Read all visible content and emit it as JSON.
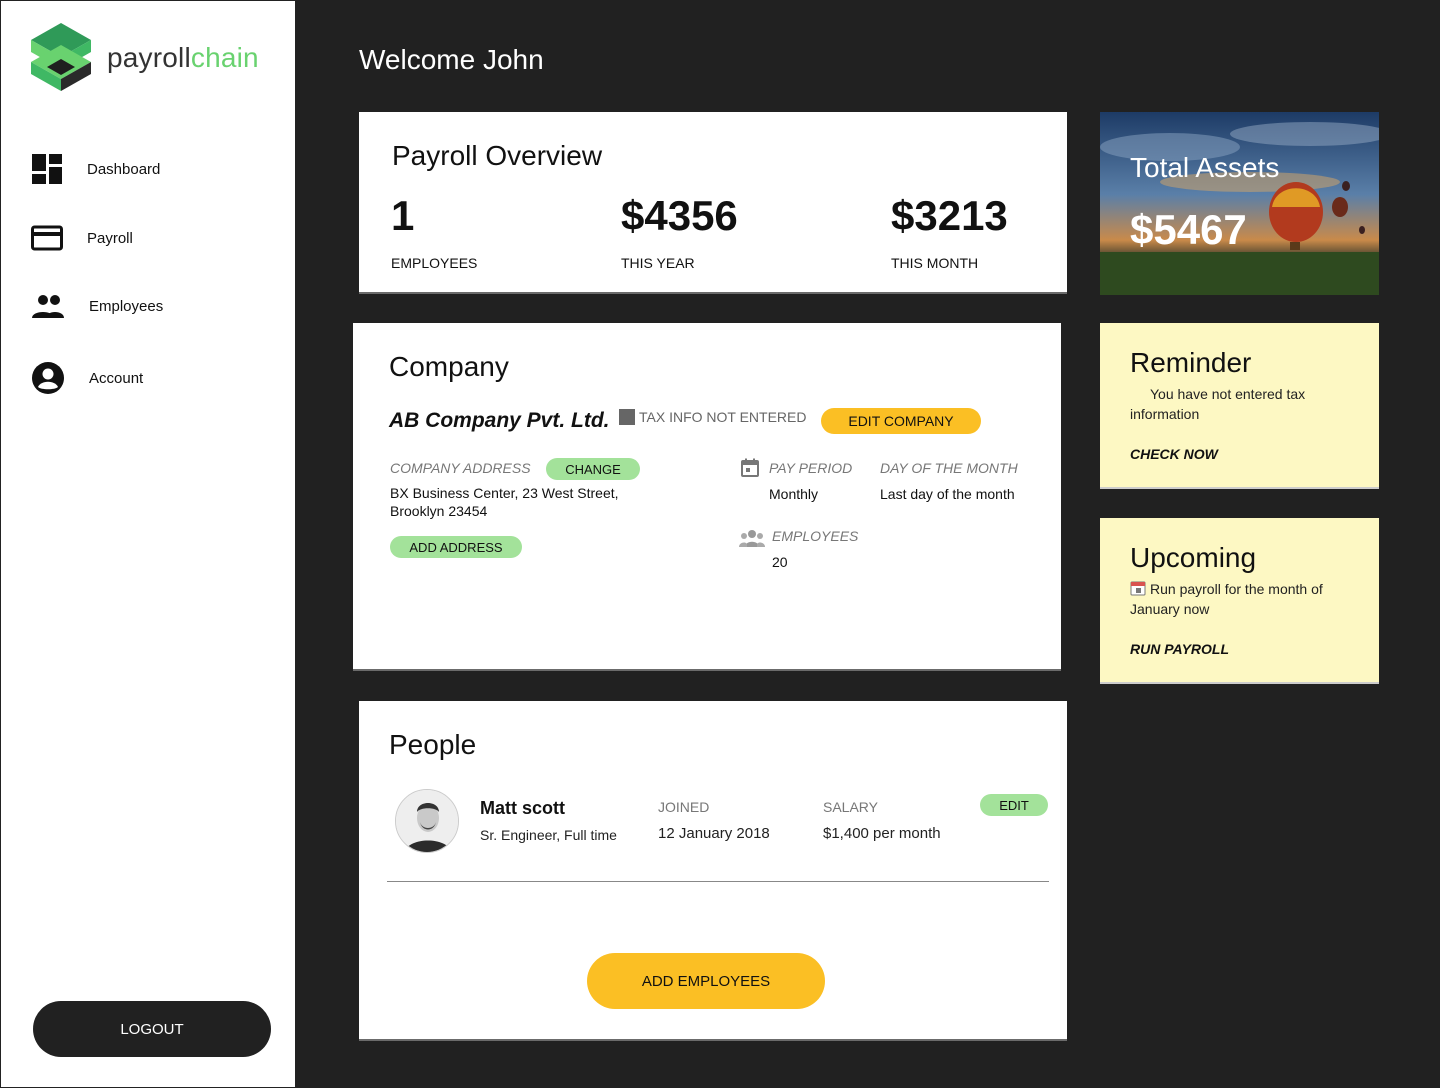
{
  "brand": {
    "name_part1": "payroll",
    "name_part2": "chain"
  },
  "sidebar": {
    "items": [
      {
        "label": "Dashboard",
        "icon": "dashboard-icon"
      },
      {
        "label": "Payroll",
        "icon": "credit-card-icon"
      },
      {
        "label": "Employees",
        "icon": "people-icon"
      },
      {
        "label": "Account",
        "icon": "account-circle-icon"
      }
    ],
    "logout_label": "LOGOUT"
  },
  "header": {
    "welcome": "Welcome John"
  },
  "overview": {
    "title": "Payroll Overview",
    "stats": [
      {
        "value": "1",
        "label": "EMPLOYEES"
      },
      {
        "value": "$4356",
        "label": "THIS YEAR"
      },
      {
        "value": "$3213",
        "label": "THIS MONTH"
      }
    ]
  },
  "company": {
    "title": "Company",
    "name": "AB Company Pvt. Ltd.",
    "tax_status": "TAX INFO NOT ENTERED",
    "edit_label": "EDIT COMPANY",
    "address_label": "COMPANY ADDRESS",
    "change_label": "CHANGE",
    "address_line1": "BX Business Center, 23 West Street,",
    "address_line2": "Brooklyn 23454",
    "add_address_label": "ADD ADDRESS",
    "pay_period_label": "PAY PERIOD",
    "pay_period_value": "Monthly",
    "day_label": "DAY OF THE MONTH",
    "day_value": "Last day of the month",
    "employees_label": "EMPLOYEES",
    "employees_value": "20"
  },
  "people": {
    "title": "People",
    "rows": [
      {
        "name": "Matt scott",
        "role": "Sr. Engineer, Full time",
        "joined_label": "JOINED",
        "joined_value": "12 January 2018",
        "salary_label": "SALARY",
        "salary_value": "$1,400 per month",
        "edit_label": "EDIT"
      }
    ],
    "add_label": "ADD EMPLOYEES"
  },
  "assets": {
    "title": "Total Assets",
    "value": "$5467"
  },
  "reminder": {
    "title": "Reminder",
    "text": "You have not entered tax information",
    "link": "CHECK NOW"
  },
  "upcoming": {
    "title": "Upcoming",
    "text": "Run payroll for the month of January now",
    "link": "RUN PAYROLL"
  },
  "colors": {
    "accent_green": "#69d26f",
    "button_yellow": "#fbbf24",
    "button_green": "#a3e29a",
    "note_bg": "#fdf8c3",
    "dark_bg": "#212121"
  }
}
